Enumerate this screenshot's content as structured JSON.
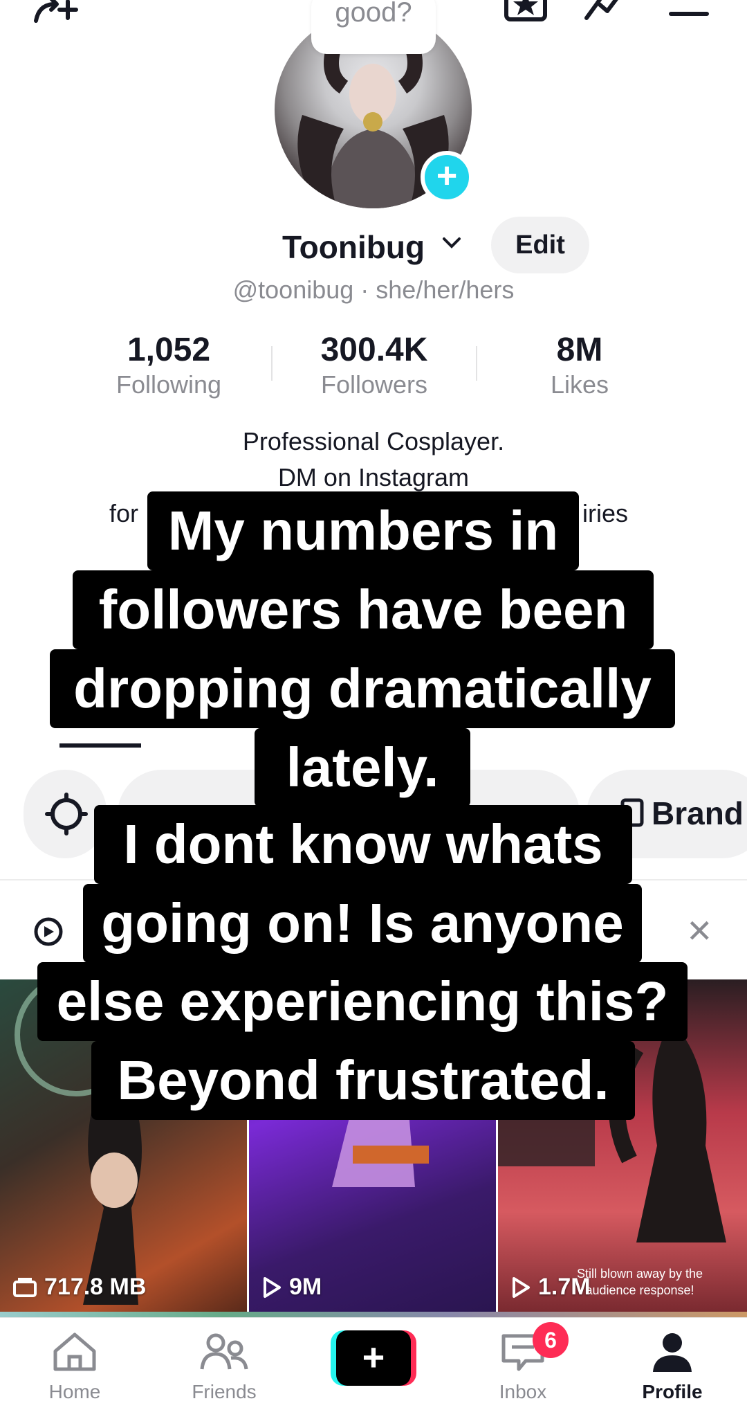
{
  "profile": {
    "bubble_text": "good?",
    "username": "Toonibug",
    "edit_label": "Edit",
    "handle_line": "@toonibug · she/her/hers"
  },
  "stats": [
    {
      "value": "1,052",
      "label": "Following"
    },
    {
      "value": "300.4K",
      "label": "Followers"
    },
    {
      "value": "8M",
      "label": "Likes"
    }
  ],
  "bio": {
    "line1": "Professional Cosplayer.",
    "line2": "DM on Instagram",
    "line3_left": "for",
    "line3_right": "iries"
  },
  "caption_lines": [
    "My numbers in",
    "followers have been",
    "dropping dramatically",
    "lately.",
    "I dont know whats",
    "going on! Is anyone",
    "else experiencing this?",
    "Beyond frustrated."
  ],
  "tabs": {
    "brand_label": "Brand"
  },
  "videos": [
    {
      "label": "717.8 MB",
      "icon": "storage-icon"
    },
    {
      "label": "9M",
      "icon": "play-icon"
    },
    {
      "label": "1.7M",
      "icon": "play-icon",
      "caption": "Still blown away by the audience response!"
    }
  ],
  "nav": {
    "home": "Home",
    "friends": "Friends",
    "inbox": "Inbox",
    "profile": "Profile",
    "inbox_badge": "6"
  },
  "colors": {
    "accent_cyan": "#25f4ee",
    "accent_red": "#fe2c55",
    "plus_badge": "#20d5ec"
  }
}
